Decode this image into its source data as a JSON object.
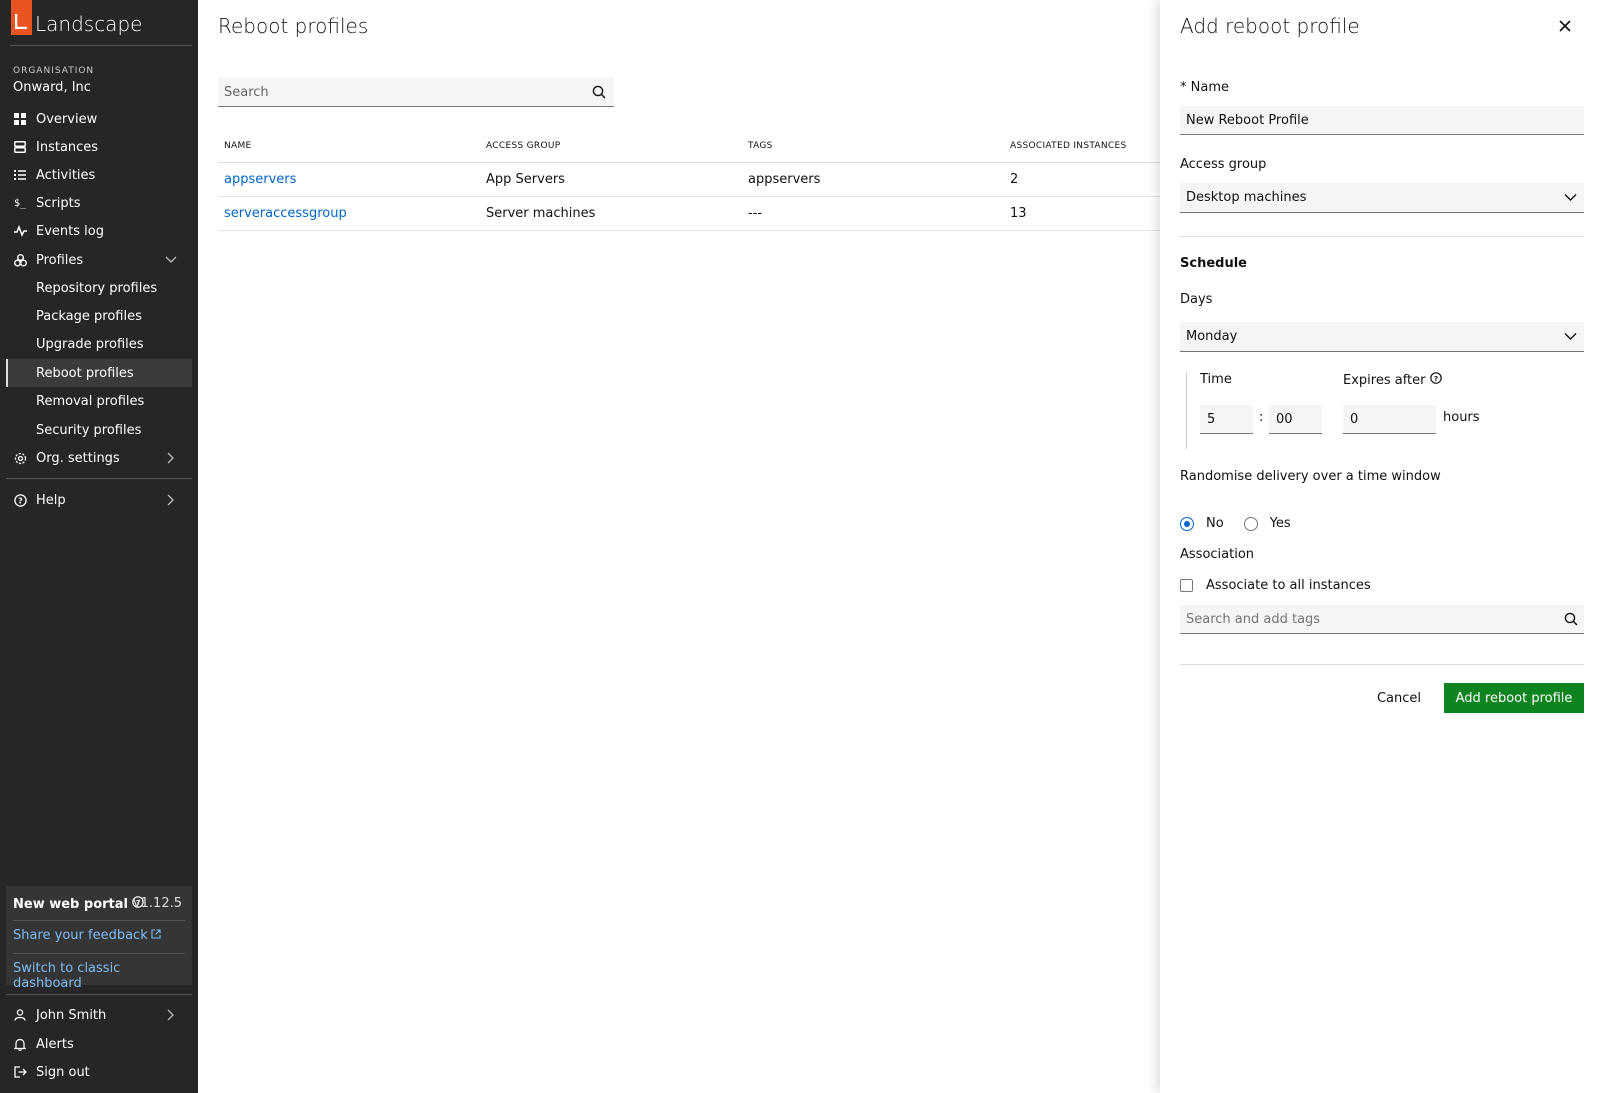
{
  "sidebar": {
    "brand": "Landscape",
    "org_label": "ORGANISATION",
    "org_name": "Onward, Inc",
    "nav": {
      "overview": "Overview",
      "instances": "Instances",
      "activities": "Activities",
      "scripts": "Scripts",
      "events_log": "Events log",
      "profiles": "Profiles",
      "org_settings": "Org. settings",
      "help": "Help"
    },
    "profiles_sub": {
      "repository": "Repository profiles",
      "package": "Package profiles",
      "upgrade": "Upgrade profiles",
      "reboot": "Reboot profiles",
      "removal": "Removal profiles",
      "security": "Security profiles"
    },
    "portal": {
      "title": "New web portal",
      "version": "v1.12.5",
      "feedback": "Share your feedback",
      "classic": "Switch to classic dashboard"
    },
    "user": {
      "name": "John Smith",
      "alerts": "Alerts",
      "sign_out": "Sign out"
    }
  },
  "main": {
    "title": "Reboot profiles",
    "search_placeholder": "Search",
    "columns": {
      "name": "NAME",
      "access_group": "ACCESS GROUP",
      "tags": "TAGS",
      "associated": "ASSOCIATED INSTANCES"
    },
    "rows": [
      {
        "name": "appservers",
        "access_group": "App Servers",
        "tags": "appservers",
        "associated": "2"
      },
      {
        "name": "serveraccessgroup",
        "access_group": "Server machines",
        "tags": "---",
        "associated": "13"
      }
    ]
  },
  "panel": {
    "title": "Add reboot profile",
    "name_label": "* Name",
    "name_value": "New Reboot Profile",
    "access_group_label": "Access group",
    "access_group_value": "Desktop machines",
    "schedule_heading": "Schedule",
    "days_label": "Days",
    "days_value": "Monday",
    "time_label": "Time",
    "time_hour": "5",
    "time_sep": ":",
    "time_minute": "00",
    "expires_label": "Expires after",
    "expires_value": "0",
    "expires_unit": "hours",
    "randomise_label": "Randomise delivery over a time window",
    "radio_no": "No",
    "radio_yes": "Yes",
    "association_label": "Association",
    "associate_all": "Associate to all instances",
    "tags_placeholder": "Search and add tags",
    "cancel": "Cancel",
    "submit": "Add reboot profile"
  },
  "colors": {
    "sidebar_bg": "#262626",
    "brand_orange": "#e95420",
    "link_blue": "#0066cc",
    "primary_green": "#0e8420"
  }
}
